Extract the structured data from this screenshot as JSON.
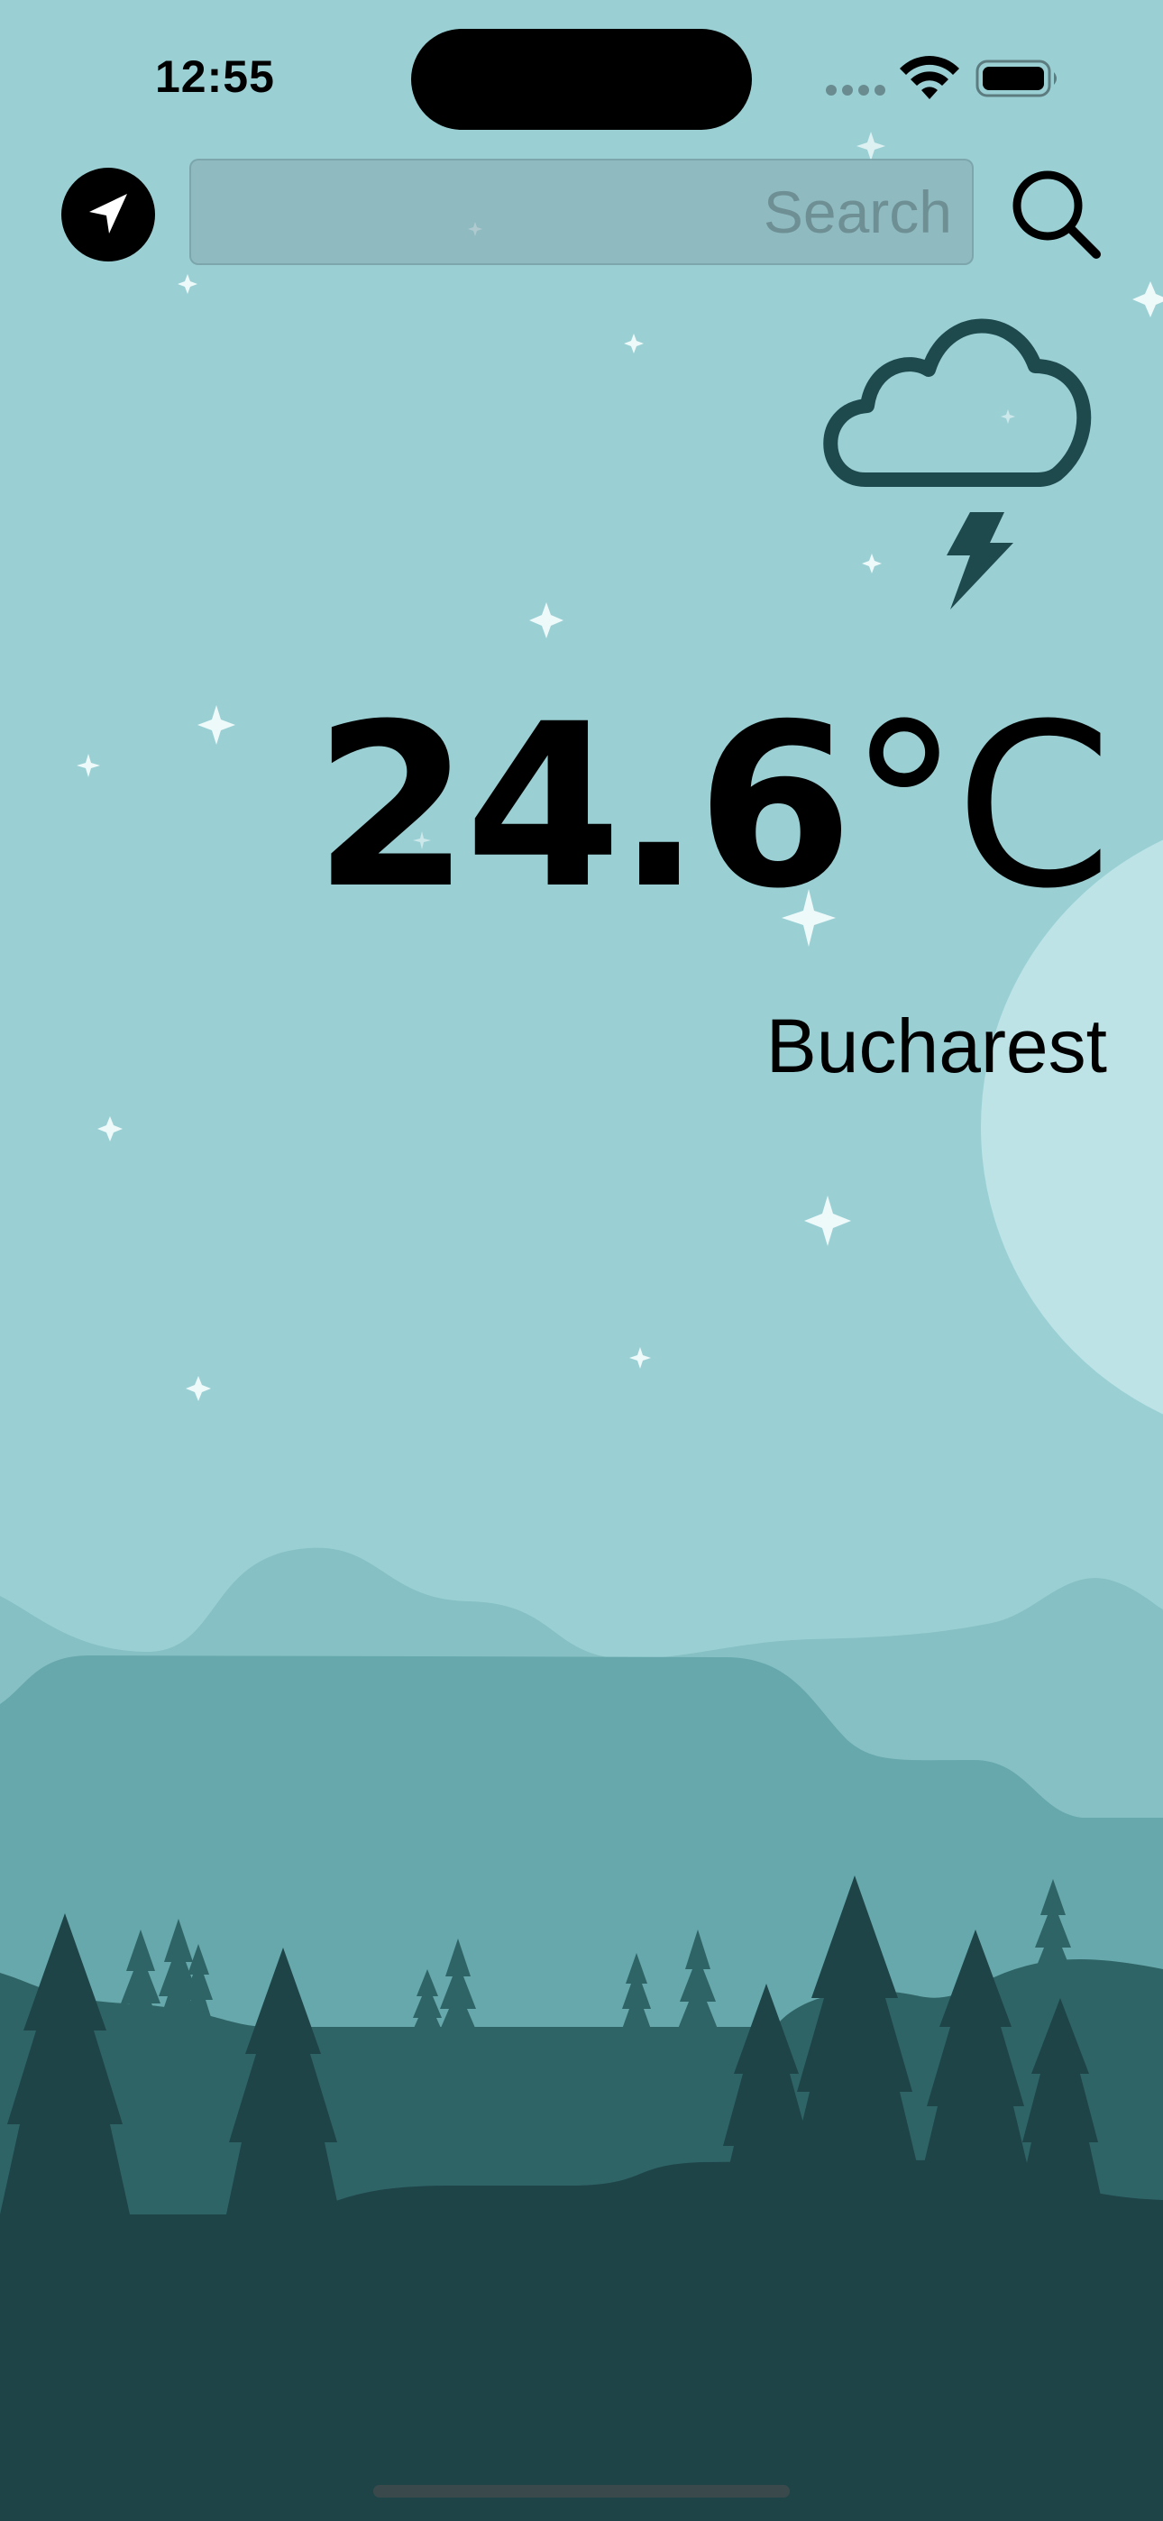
{
  "status_bar": {
    "time": "12:55"
  },
  "search": {
    "placeholder": "Search",
    "value": ""
  },
  "weather": {
    "temperature": "24.6",
    "unit": "°C",
    "city": "Bucharest",
    "condition_icon": "cloud-lightning-icon"
  },
  "colors": {
    "sky": "#9ad0d4",
    "moon": "#bde3e6",
    "icon_stroke": "#1e4a4e",
    "far_hills": "#86c0c4",
    "mid_hills": "#66a8ac",
    "forest_back": "#2f6466",
    "forest_front": "#1e4448"
  }
}
